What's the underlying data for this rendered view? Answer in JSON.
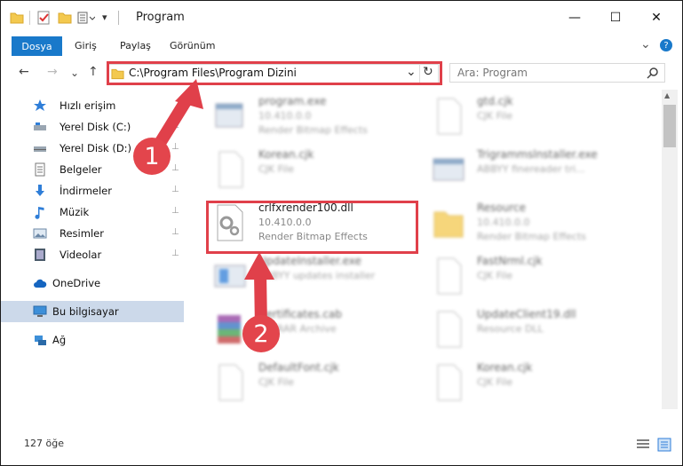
{
  "window": {
    "title": "Program",
    "minimize": "—",
    "maximize": "☐",
    "close": "✕"
  },
  "ribbon": {
    "file_tab": "Dosya",
    "tabs": [
      "Giriş",
      "Paylaş",
      "Görünüm"
    ],
    "expand": "⌄",
    "help": "?"
  },
  "address": {
    "back": "←",
    "forward": "→",
    "recent": "⌄",
    "up": "↑",
    "path": "C:\\Program Files\\Program Dizini",
    "dropdown": "⌄",
    "refresh": "↻",
    "search_placeholder": "Ara: Program"
  },
  "sidebar": {
    "items": [
      {
        "label": "Hızlı erişim",
        "icon": "star-icon",
        "pinned": false
      },
      {
        "label": "Yerel Disk (C:)",
        "icon": "drive-icon",
        "pinned": true
      },
      {
        "label": "Yerel Disk (D:)",
        "icon": "drive-icon",
        "pinned": true
      },
      {
        "label": "Belgeler",
        "icon": "document-icon",
        "pinned": true
      },
      {
        "label": "İndirmeler",
        "icon": "download-icon",
        "pinned": true
      },
      {
        "label": "Müzik",
        "icon": "music-icon",
        "pinned": true
      },
      {
        "label": "Resimler",
        "icon": "pictures-icon",
        "pinned": true
      },
      {
        "label": "Videolar",
        "icon": "video-icon",
        "pinned": true
      },
      {
        "label": "OneDrive",
        "icon": "cloud-icon",
        "pinned": false
      },
      {
        "label": "Bu bilgisayar",
        "icon": "computer-icon",
        "pinned": false
      },
      {
        "label": "Ağ",
        "icon": "network-icon",
        "pinned": false
      }
    ],
    "pin_glyph": "📌"
  },
  "files": [
    {
      "name": "program.exe",
      "line1": "10.410.0.0",
      "line2": "Render Bitmap Effects",
      "icon": "exe-icon",
      "blurred": true
    },
    {
      "name": "gtd.cjk",
      "line1": "CJK File",
      "line2": "",
      "icon": "file-icon",
      "blurred": true
    },
    {
      "name": "Korean.cjk",
      "line1": "CJK File",
      "line2": "",
      "icon": "file-icon",
      "blurred": true
    },
    {
      "name": "Trigrammslnstaller.exe",
      "line1": "ABBYY finereader tri...",
      "line2": "",
      "icon": "installer-icon",
      "blurred": true
    },
    {
      "name": "crlfxrender100.dll",
      "line1": "10.410.0.0",
      "line2": "Render Bitmap Effects",
      "icon": "dll-icon",
      "blurred": false
    },
    {
      "name": "Resource",
      "line1": "10.410.0.0",
      "line2": "Render Bitmap Effects",
      "icon": "folder-icon",
      "blurred": true
    },
    {
      "name": "UpdateInstaller.exe",
      "line1": "ABBYY updates installer",
      "line2": "",
      "icon": "installer-icon",
      "blurred": true
    },
    {
      "name": "FastNrml.cjk",
      "line1": "CJK File",
      "line2": "",
      "icon": "file-icon",
      "blurred": true
    },
    {
      "name": "Certificates.cab",
      "line1": "WinRAR Archive",
      "line2": "",
      "icon": "archive-icon",
      "blurred": true
    },
    {
      "name": "UpdateClient19.dll",
      "line1": "Resource DLL",
      "line2": "",
      "icon": "file-icon",
      "blurred": true
    },
    {
      "name": "DefaultFont.cjk",
      "line1": "CJK File",
      "line2": "",
      "icon": "file-icon",
      "blurred": true
    },
    {
      "name": "Korean.cjk",
      "line1": "CJK File",
      "line2": "",
      "icon": "file-icon",
      "blurred": true
    }
  ],
  "status": {
    "count": "127 öğe"
  },
  "annotations": [
    "1",
    "2"
  ],
  "colors": {
    "accent": "#1979ca",
    "highlight": "#e0404a",
    "selected": "#ccd9ea"
  }
}
